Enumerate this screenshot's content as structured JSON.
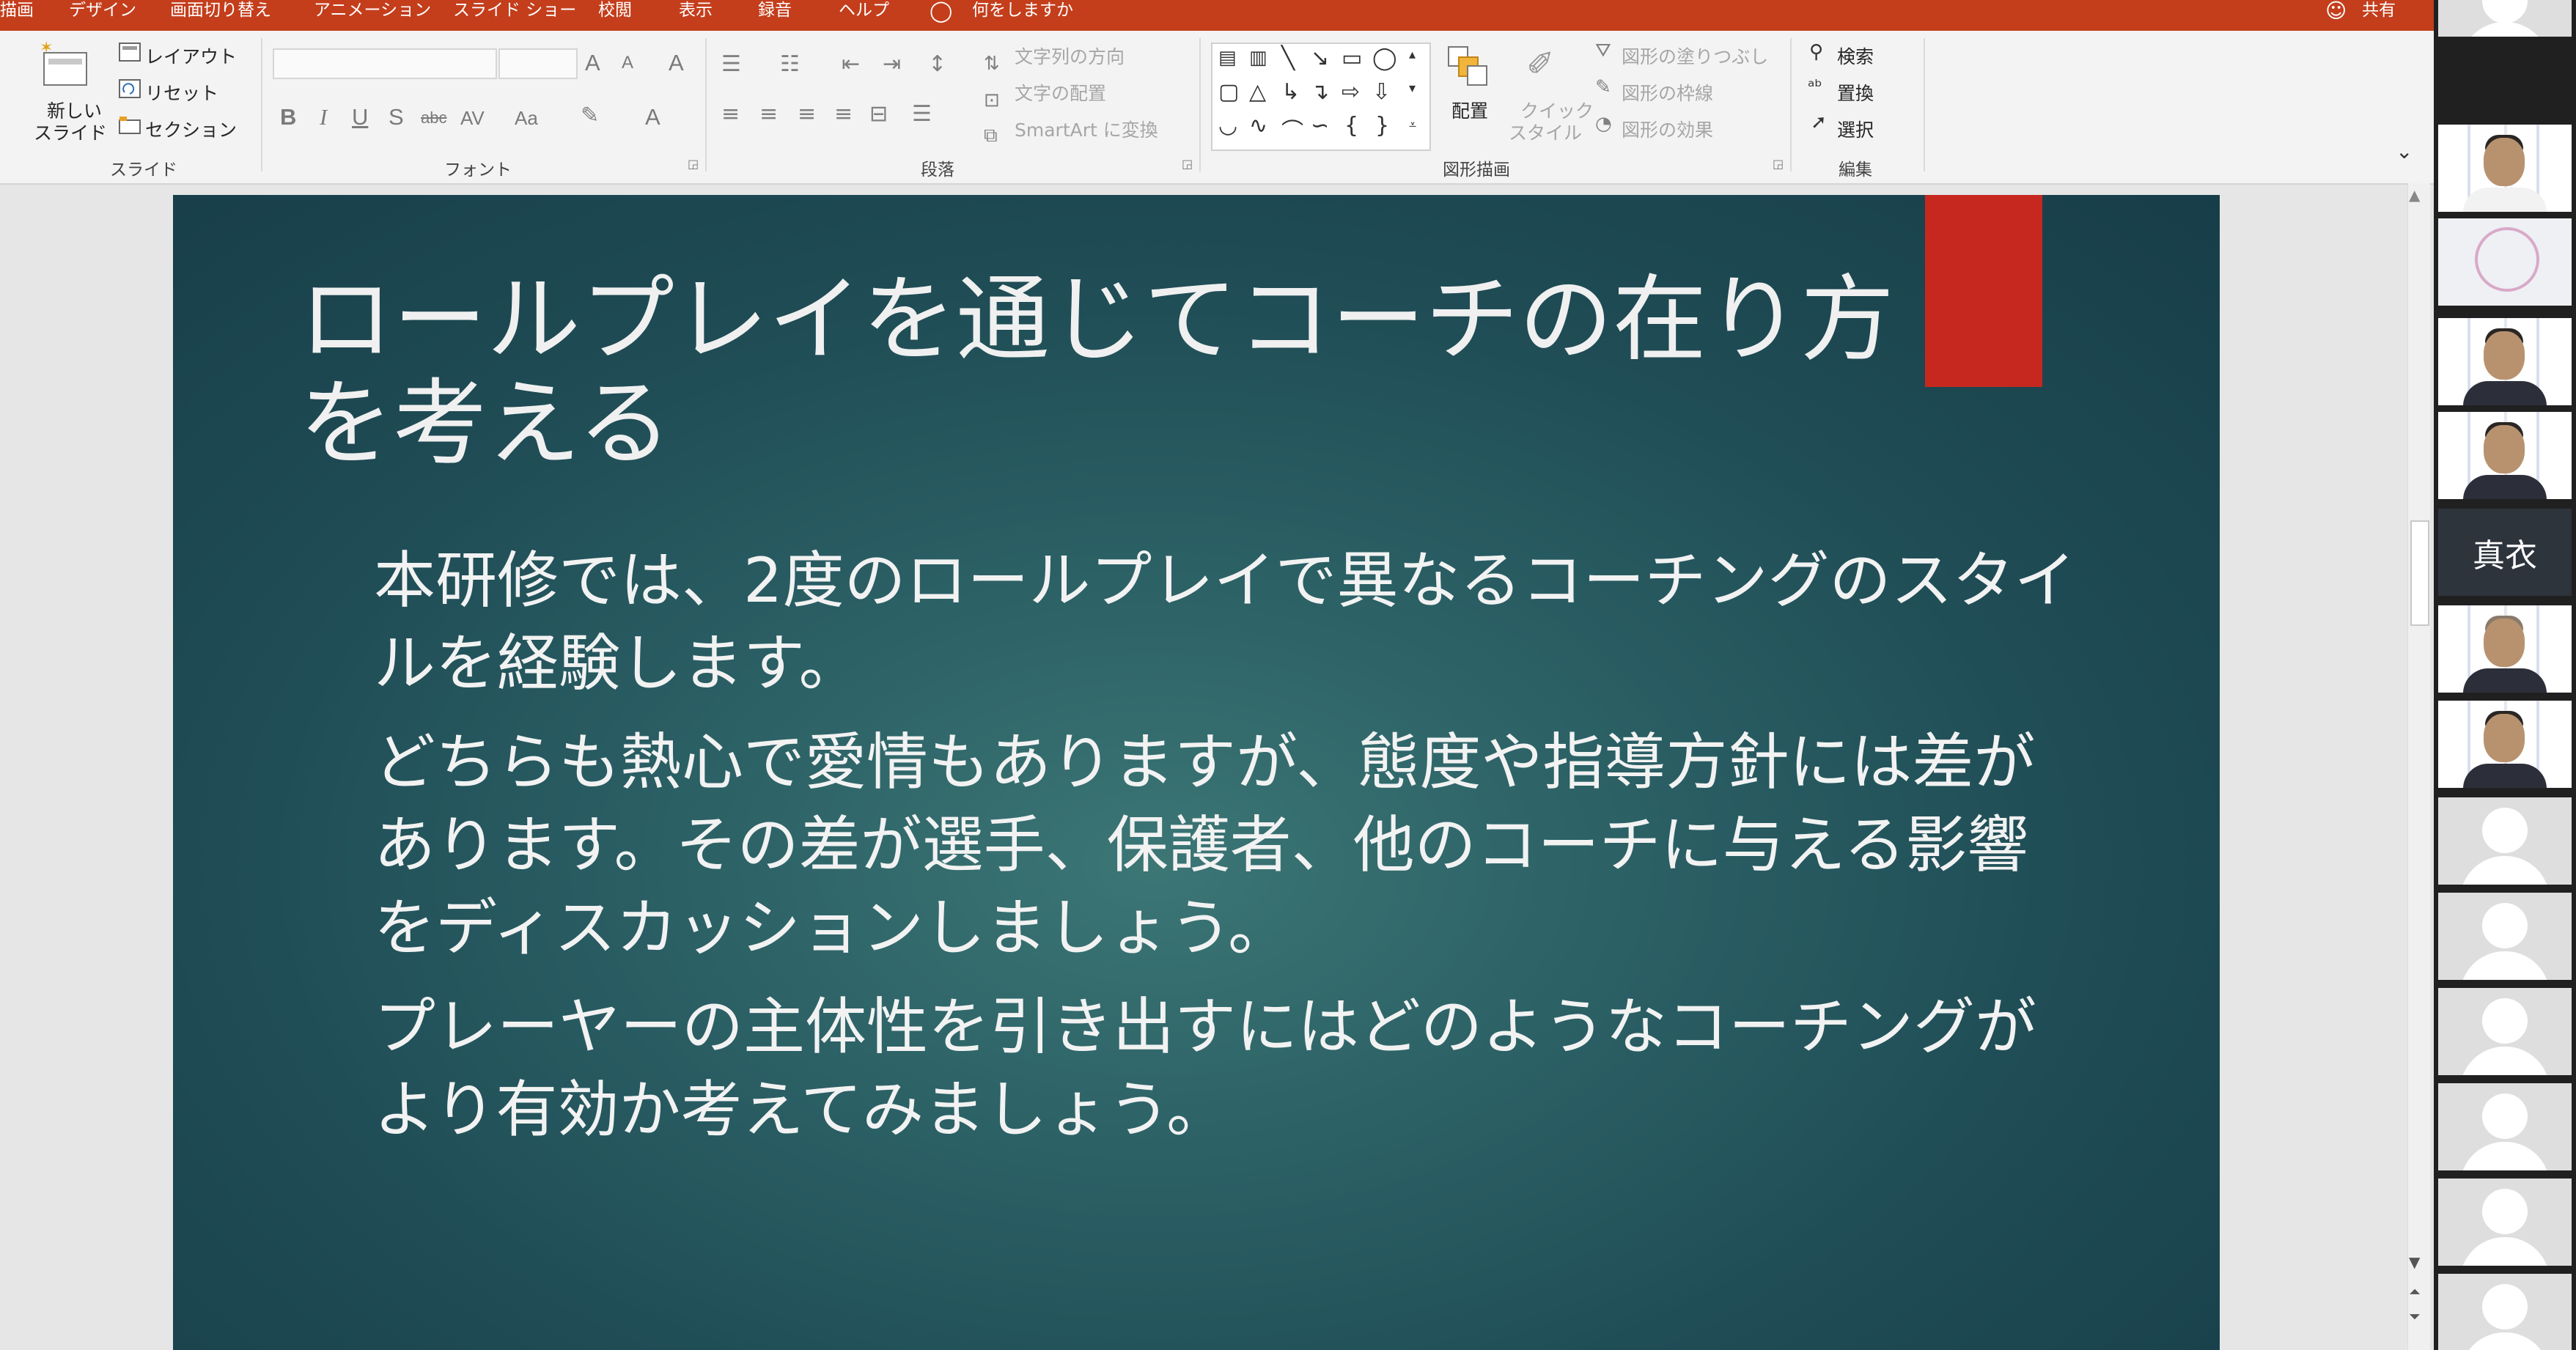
{
  "menu": {
    "tabs": [
      "描画",
      "デザイン",
      "画面切り替え",
      "アニメーション",
      "スライド ショー",
      "校閲",
      "表示",
      "録音",
      "ヘルプ"
    ],
    "tell_me": "何をしますか",
    "share": "共有"
  },
  "ribbon": {
    "slides_group": {
      "new_slide": "新しい",
      "new_slide_2": "スライド",
      "layout": "レイアウト",
      "reset": "リセット",
      "section": "セクション",
      "label": "スライド"
    },
    "font_group": {
      "label": "フォント",
      "bold": "B",
      "italic": "I",
      "underline": "U",
      "shadow": "S",
      "strike": "abc",
      "spacing": "AV",
      "case": "Aa",
      "increase": "A",
      "decrease": "A",
      "clear": "A",
      "color": "A"
    },
    "paragraph_group": {
      "label": "段落",
      "text_direction": "文字列の方向",
      "align_text": "文字の配置",
      "smartart": "SmartArt に変換"
    },
    "drawing_group": {
      "label": "図形描画",
      "arrange": "配置",
      "quick_styles": "クイック",
      "quick_styles_2": "スタイル",
      "shape_fill": "図形の塗りつぶし",
      "shape_outline": "図形の枠線",
      "shape_effects": "図形の効果"
    },
    "editing_group": {
      "label": "編集",
      "find": "検索",
      "replace": "置換",
      "select": "選択"
    }
  },
  "slide": {
    "title": "ロールプレイを通じてコーチの在り方を考える",
    "paragraphs": [
      "本研修では、2度のロールプレイで異なるコーチングのスタイルを経験します。",
      "どちらも熱心で愛情もありますが、態度や指導方針には差があります。その差が選手、保護者、他のコーチに与える影響をディスカッションしましょう。",
      "プレーヤーの主体性を引き出すにはどのようなコーチングがより有効か考えてみましょう。"
    ]
  },
  "participants": {
    "name_tile": "真衣"
  },
  "colors": {
    "menu_bar": "#c43e1c",
    "slide_bg": "#1f4c55",
    "accent": "#c6281f"
  }
}
